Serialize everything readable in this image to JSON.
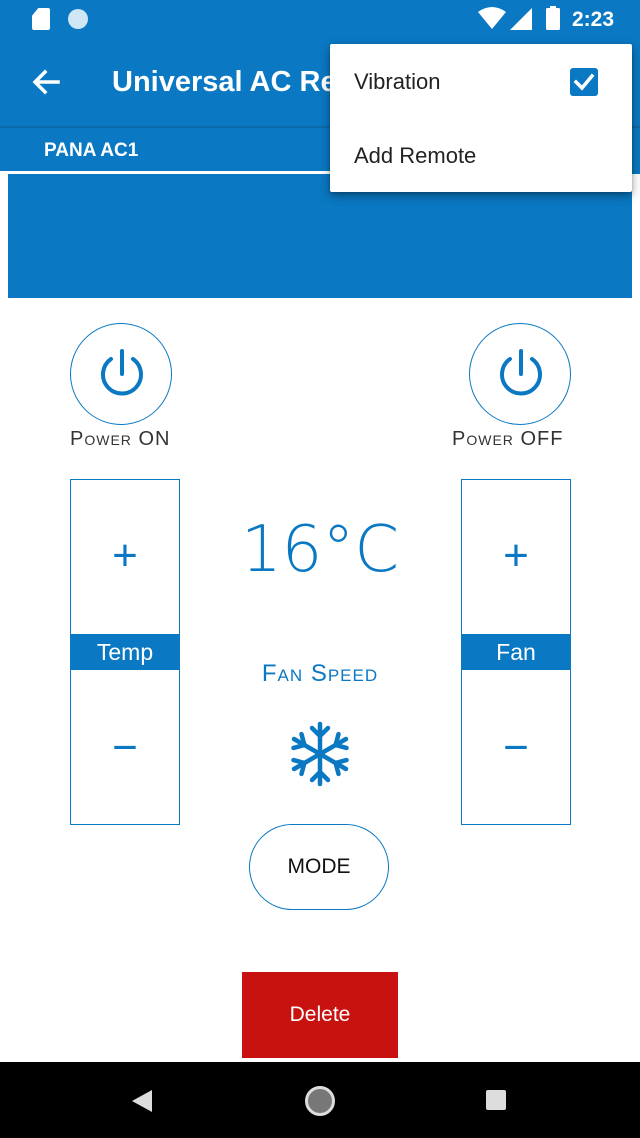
{
  "status_bar": {
    "time": "2:23"
  },
  "toolbar": {
    "title": "Universal AC Re"
  },
  "tabs": [
    {
      "label": "PANA AC1"
    }
  ],
  "remote": {
    "power_on_label": "Power ON",
    "power_off_label": "Power OFF",
    "temp_label": "Temp",
    "fan_label": "Fan",
    "plus_symbol": "+",
    "minus_symbol": "−",
    "temperature": "16°C",
    "fan_speed_label": "Fan Speed",
    "mode_label": "MODE",
    "delete_label": "Delete"
  },
  "menu": {
    "items": [
      {
        "label": "Vibration",
        "checked": true
      },
      {
        "label": "Add Remote"
      }
    ]
  },
  "colors": {
    "primary": "#0a78c2",
    "danger": "#c8120f",
    "nav": "#000000"
  },
  "icons": [
    "sd-card-icon",
    "notification-dot-icon",
    "wifi-icon",
    "signal-icon",
    "battery-icon",
    "back-arrow-icon",
    "power-icon",
    "snowflake-icon",
    "checkbox-checked-icon",
    "nav-back-icon",
    "nav-home-icon",
    "nav-recents-icon"
  ]
}
